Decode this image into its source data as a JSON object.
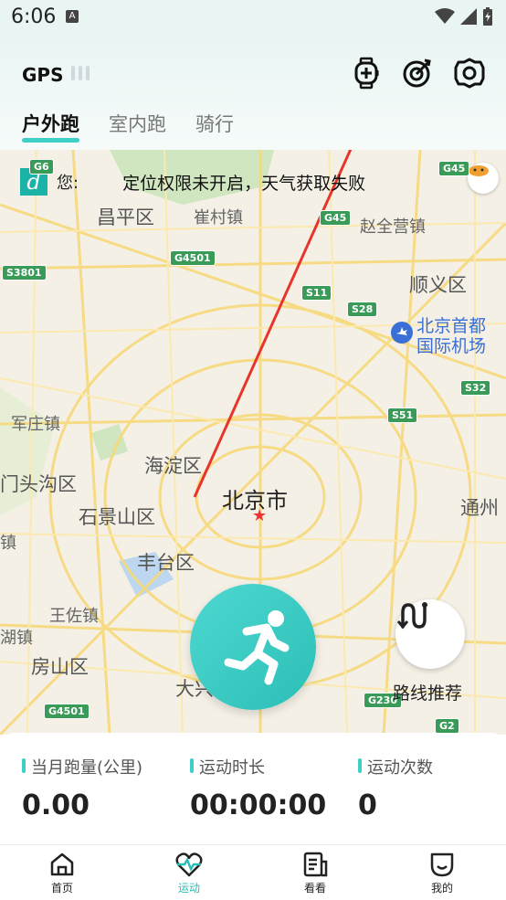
{
  "status_bar": {
    "time": "6:06"
  },
  "header": {
    "gps_label": "GPS"
  },
  "tabs": [
    {
      "label": "户外跑",
      "active": true
    },
    {
      "label": "室内跑",
      "active": false
    },
    {
      "label": "骑行",
      "active": false
    }
  ],
  "weather": {
    "greeting": "您:",
    "message": "定位权限未开启，天气获取失败"
  },
  "map": {
    "labels": {
      "changping": "昌平区",
      "cuicun": "崔村镇",
      "zhaoquanying": "赵全营镇",
      "shunyi": "顺义区",
      "airport": "北京首都\n国际机场",
      "wangzhuang": "军庄镇",
      "haidian": "海淀区",
      "mentougou": "门头沟区",
      "beijing": "北京市",
      "shijingshan": "石景山区",
      "tongzhou": "通州",
      "fengtai": "丰台区",
      "zhen_left": "镇",
      "wangzuo": "王佐镇",
      "hu_left": "湖镇",
      "fangshan": "房山区",
      "daxing": "大兴"
    },
    "shields": {
      "g6": "G6",
      "g45a": "G45",
      "g45b": "G45",
      "g4501a": "G4501",
      "s3801": "S3801",
      "s11": "S11",
      "s28": "S28",
      "s32": "S32",
      "s51": "S51",
      "g4501b": "G4501",
      "g230": "G230",
      "g2": "G2"
    }
  },
  "route_label": "路线推荐",
  "stats": [
    {
      "label": "当月跑量(公里)",
      "value": "0.00"
    },
    {
      "label": "运动时长",
      "value": "00:00:00"
    },
    {
      "label": "运动次数",
      "value": "0"
    }
  ],
  "tabbar": [
    {
      "label": "首页",
      "icon": "home-icon",
      "active": false
    },
    {
      "label": "运动",
      "icon": "heartbeat-icon",
      "active": true
    },
    {
      "label": "看看",
      "icon": "article-icon",
      "active": false
    },
    {
      "label": "我的",
      "icon": "smile-icon",
      "active": false
    }
  ],
  "colors": {
    "accent": "#3ecfc7",
    "arrow": "#e8352c"
  }
}
